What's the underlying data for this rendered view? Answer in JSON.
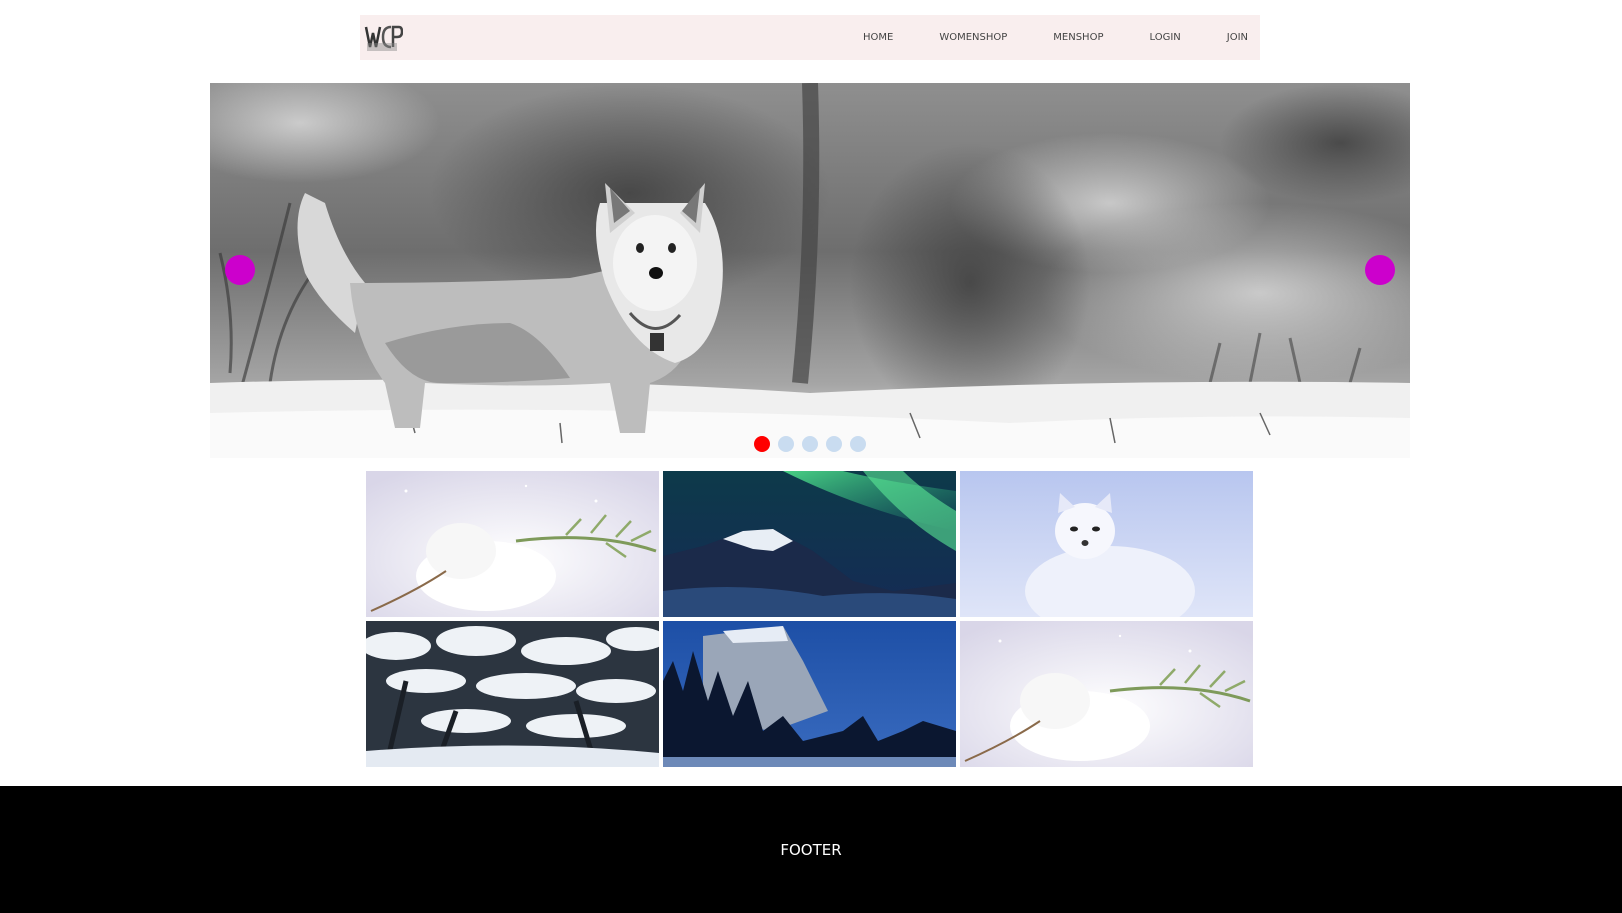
{
  "header": {
    "logo_icon": "wcp-logo-icon",
    "nav": [
      {
        "label": "HOME"
      },
      {
        "label": "WOMENSHOP"
      },
      {
        "label": "MENSHOP"
      },
      {
        "label": "LOGIN"
      },
      {
        "label": "JOIN"
      }
    ],
    "background": "#f9eeee"
  },
  "slider": {
    "slide_icon": "corgi-in-snow-photo",
    "arrow_color": "#cc00cc",
    "active_index": 0,
    "slide_count": 5,
    "active_dot_color": "#ff0000",
    "inactive_dot_color": "#c9dcf0"
  },
  "gallery": {
    "tiles": [
      {
        "icon": "snowy-branch-photo"
      },
      {
        "icon": "aurora-mountain-photo"
      },
      {
        "icon": "arctic-fox-photo"
      },
      {
        "icon": "snowy-trees-photo"
      },
      {
        "icon": "night-cliff-forest-photo"
      },
      {
        "icon": "snowy-branch-photo"
      }
    ]
  },
  "footer": {
    "label": "FOOTER"
  }
}
